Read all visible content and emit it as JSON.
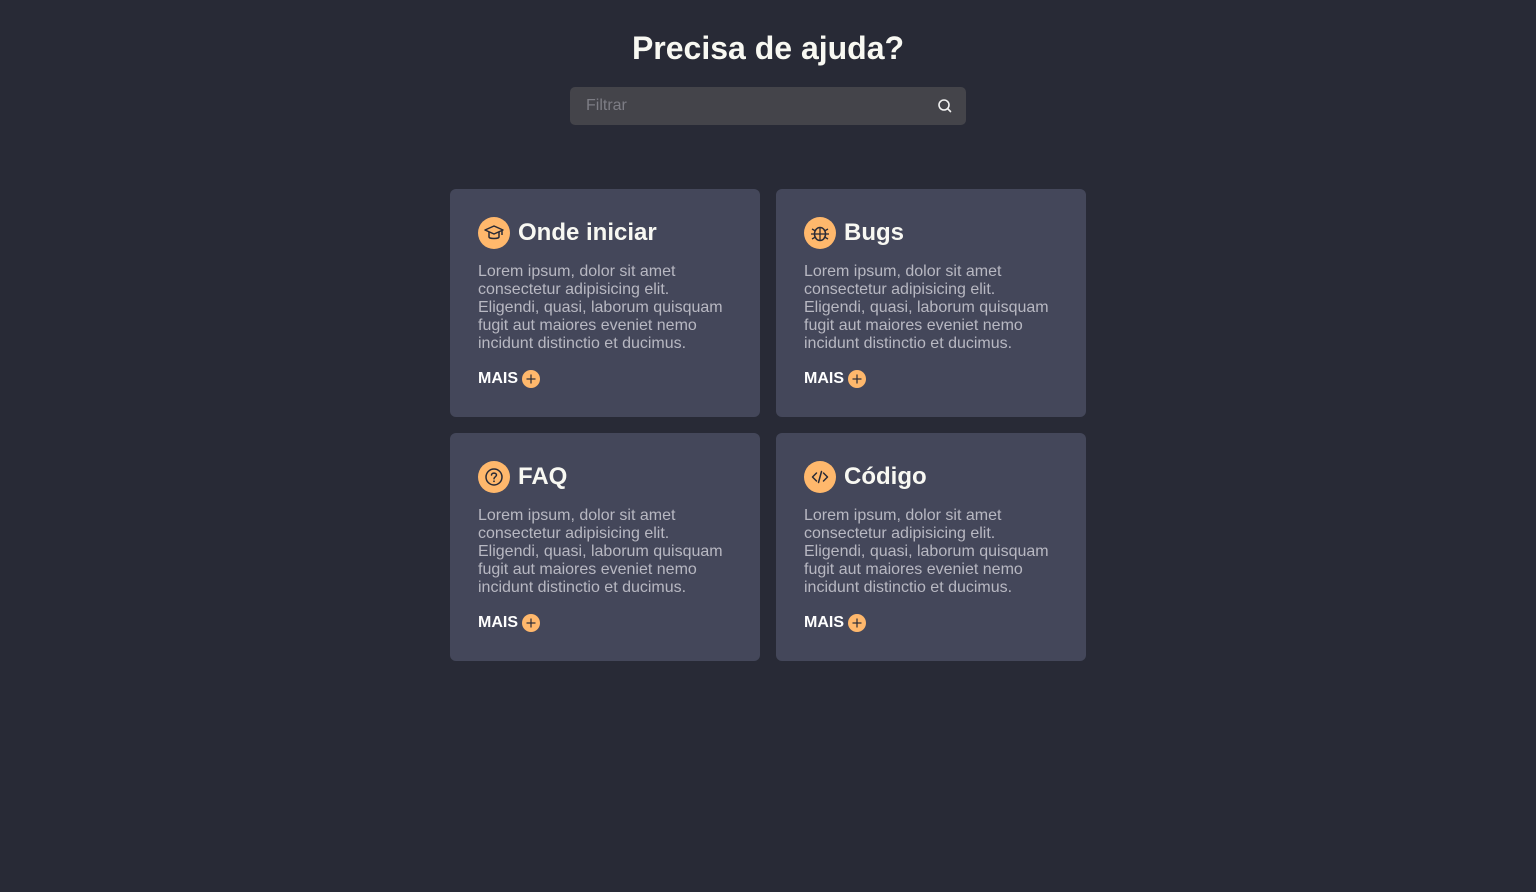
{
  "header": {
    "title": "Precisa de ajuda?"
  },
  "search": {
    "placeholder": "Filtrar",
    "value": "",
    "icon": "search-icon"
  },
  "colors": {
    "background": "#282a36",
    "card": "#44475a",
    "accent": "#ffb86c",
    "search_bg": "#44444a"
  },
  "cards": [
    {
      "title": "Onde iniciar",
      "icon": "graduation-cap-icon",
      "text": "Lorem ipsum, dolor sit amet consectetur adipisicing elit. Eligendi, quasi, laborum quisquam fugit aut maiores eveniet nemo incidunt distinctio et ducimus.",
      "more_label": "MAIS"
    },
    {
      "title": "Bugs",
      "icon": "bug-icon",
      "text": "Lorem ipsum, dolor sit amet consectetur adipisicing elit. Eligendi, quasi, laborum quisquam fugit aut maiores eveniet nemo incidunt distinctio et ducimus.",
      "more_label": "MAIS"
    },
    {
      "title": "FAQ",
      "icon": "question-icon",
      "text": "Lorem ipsum, dolor sit amet consectetur adipisicing elit. Eligendi, quasi, laborum quisquam fugit aut maiores eveniet nemo incidunt distinctio et ducimus.",
      "more_label": "MAIS"
    },
    {
      "title": "Código",
      "icon": "code-icon",
      "text": "Lorem ipsum, dolor sit amet consectetur adipisicing elit. Eligendi, quasi, laborum quisquam fugit aut maiores eveniet nemo incidunt distinctio et ducimus.",
      "more_label": "MAIS"
    }
  ]
}
